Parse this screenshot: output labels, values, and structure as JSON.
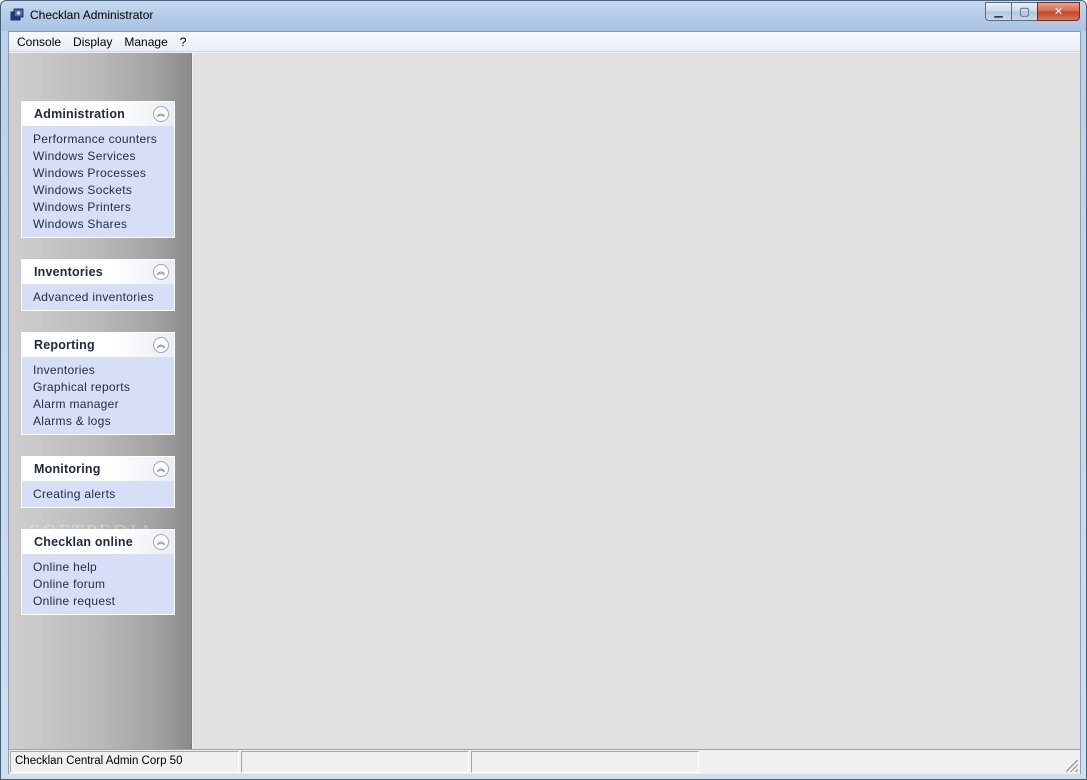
{
  "window": {
    "title": "Checklan Administrator",
    "buttons": {
      "minimize": "▁",
      "maximize": "▢",
      "close": "✕"
    }
  },
  "menubar": {
    "items": [
      "Console",
      "Display",
      "Manage",
      "?"
    ]
  },
  "sidebar": {
    "groups": [
      {
        "title": "Administration",
        "links": [
          "Performance counters",
          "Windows Services",
          "Windows Processes",
          "Windows Sockets",
          "Windows Printers",
          "Windows Shares"
        ]
      },
      {
        "title": "Inventories",
        "links": [
          "Advanced inventories"
        ]
      },
      {
        "title": "Reporting",
        "links": [
          "Inventories",
          "Graphical reports",
          "Alarm manager",
          "Alarms & logs"
        ]
      },
      {
        "title": "Monitoring",
        "links": [
          "Creating alerts"
        ]
      },
      {
        "title": "Checklan online",
        "links": [
          "Online help",
          "Online forum",
          "Online request"
        ]
      }
    ],
    "collapse_icon": "chevron-double-up-icon"
  },
  "statusbar": {
    "cells": [
      "Checklan Central Admin Corp 50",
      "",
      ""
    ]
  },
  "watermark": "SOFTPEDIA",
  "colors": {
    "panel_link_bg": "#d6dff6",
    "main_bg": "#e1e1e1",
    "close_red": "#c2452b"
  }
}
